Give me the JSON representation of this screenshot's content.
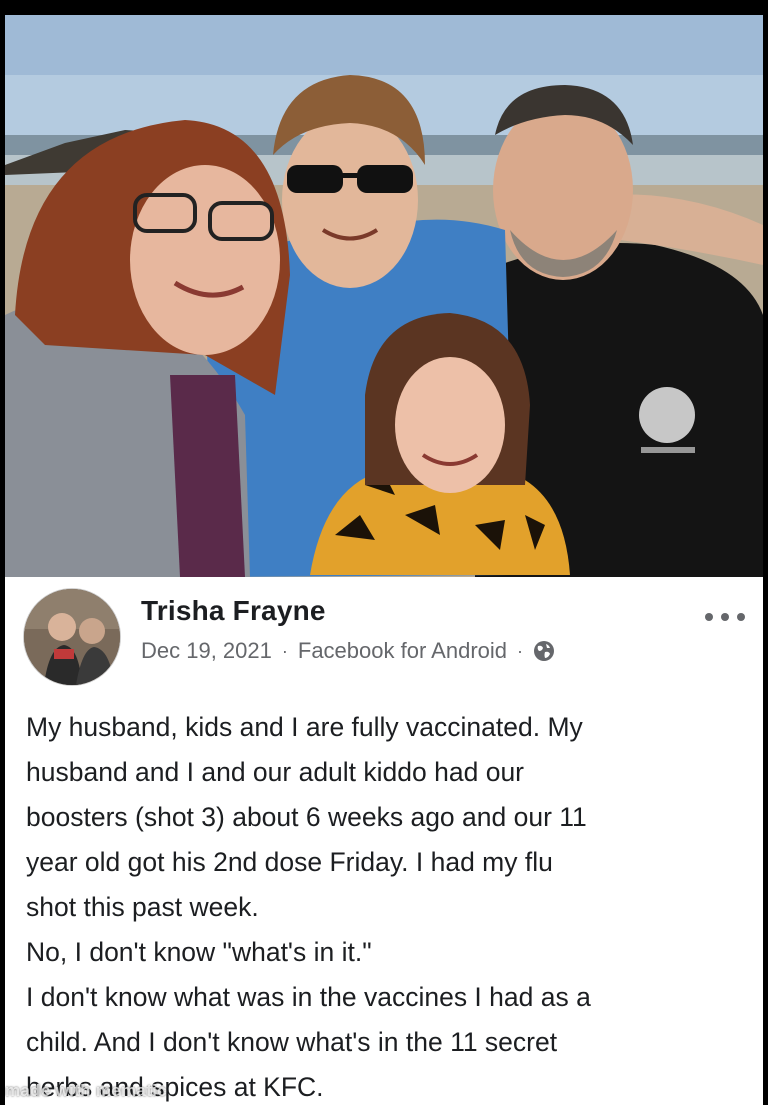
{
  "post": {
    "author_name": "Trisha Frayne",
    "date": "Dec 19, 2021",
    "separator": "·",
    "source": "Facebook for Android",
    "audience_icon": "globe-icon",
    "more_icon": "more-options-icon",
    "body_lines": [
      "My husband, kids and I are fully vaccinated. My",
      "husband and I and our adult kiddo had our",
      "boosters (shot 3) about 6 weeks ago and our 11",
      "year old got his 2nd dose Friday. I had my flu",
      "shot this past week.",
      "No, I don't know \"what's in it.\"",
      "I don't know what was in the vaccines I had as a",
      "child.  And I don't know what's in the 11 secret",
      "herbs and spices at KFC."
    ]
  },
  "watermark": "made with mematic",
  "colors": {
    "text_primary": "#1c1e21",
    "text_secondary": "#65676b",
    "background": "#ffffff"
  }
}
